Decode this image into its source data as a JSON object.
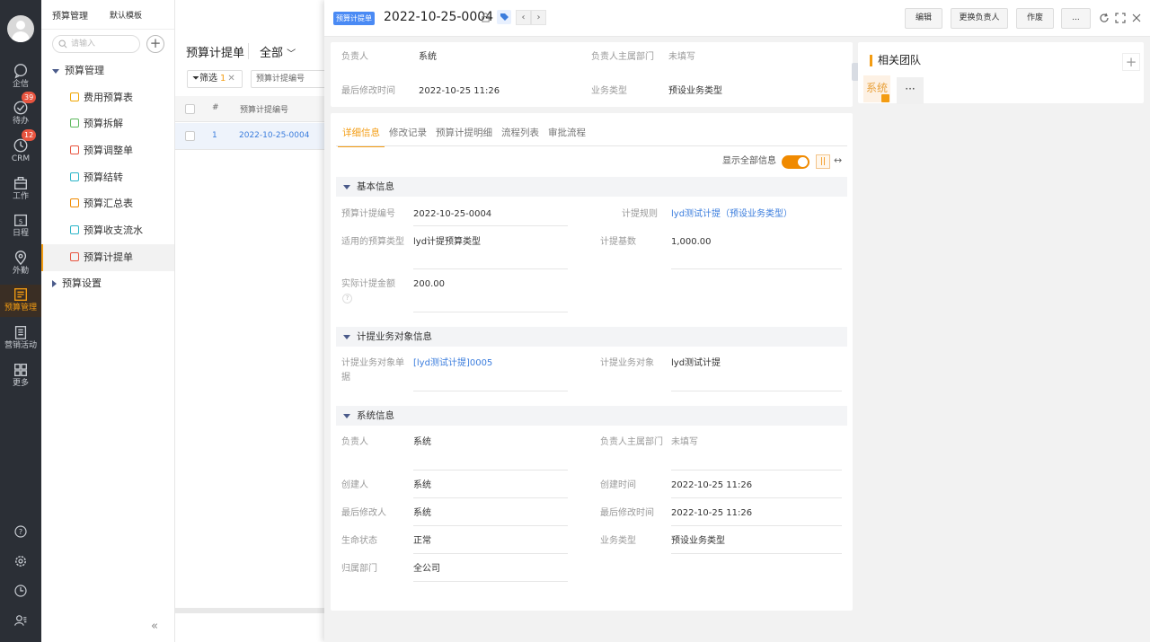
{
  "rail": {
    "items": [
      {
        "label": "企信",
        "icon": "chat-icon"
      },
      {
        "label": "待办",
        "icon": "check-circle-icon",
        "badge": "39"
      },
      {
        "label": "CRM",
        "icon": "clock-icon",
        "badge": "12"
      },
      {
        "label": "工作",
        "icon": "briefcase-icon"
      },
      {
        "label": "日程",
        "icon": "calendar-icon",
        "day": "5"
      },
      {
        "label": "外勤",
        "icon": "location-icon"
      },
      {
        "label": "预算管理",
        "icon": "budget-icon",
        "active": true
      },
      {
        "label": "营销活动",
        "icon": "marketing-icon"
      },
      {
        "label": "更多",
        "icon": "grid-icon"
      }
    ],
    "bottom_icons": [
      "help-icon",
      "settings-icon",
      "history-icon",
      "contacts-icon"
    ],
    "accent": "#f39c12"
  },
  "tree": {
    "tabs": [
      "预算管理",
      "默认模板"
    ],
    "search_placeholder": "请输入",
    "group_open": "预算管理",
    "items": [
      {
        "label": "费用预算表",
        "color": "#f0a500"
      },
      {
        "label": "预算拆解",
        "color": "#5cb85c"
      },
      {
        "label": "预算调整单",
        "color": "#e8543f"
      },
      {
        "label": "预算结转",
        "color": "#2bb5c8"
      },
      {
        "label": "预算汇总表",
        "color": "#f08a00"
      },
      {
        "label": "预算收支流水",
        "color": "#2bb5c8"
      },
      {
        "label": "预算计提单",
        "color": "#e8543f",
        "active": true
      }
    ],
    "group_closed": "预算设置",
    "collapse": "«"
  },
  "list": {
    "title": "预算计提单",
    "scope": "全部",
    "filter_label": "筛选",
    "filter_count": "1",
    "field_select": "预算计提编号",
    "columns": [
      "#",
      "预算计提编号"
    ],
    "rows": [
      {
        "index": "1",
        "code": "2022-10-25-0004"
      }
    ]
  },
  "detail": {
    "object_tag": "预算计提单",
    "title": "2022-10-25-0004",
    "prev": "‹",
    "next": "›",
    "buttons": [
      "编辑",
      "更换负责人",
      "作废",
      "..."
    ],
    "summary": {
      "owner_label": "负责人",
      "owner": "系统",
      "dept_label": "负责人主属部门",
      "dept": "未填写",
      "modified_label": "最后修改时间",
      "modified": "2022-10-25 11:26",
      "biztype_label": "业务类型",
      "biztype": "预设业务类型"
    },
    "tabs": [
      "详细信息",
      "修改记录",
      "预算计提明细",
      "流程列表",
      "审批流程"
    ],
    "show_all_label": "显示全部信息",
    "sections": {
      "basic": {
        "title": "基本信息",
        "code_label": "预算计提编号",
        "code": "2022-10-25-0004",
        "rule_label": "计提规则",
        "rule": "lyd测试计提（预设业务类型）",
        "type_label": "适用的预算类型",
        "type": "lyd计提预算类型",
        "base_label": "计提基数",
        "base": "1,000.00",
        "actual_label": "实际计提金额",
        "actual": "200.00",
        "help": "?"
      },
      "object": {
        "title": "计提业务对象信息",
        "doc_label": "计提业务对象单据",
        "doc": "[lyd测试计提]0005",
        "obj_label": "计提业务对象",
        "obj": "lyd测试计提"
      },
      "system": {
        "title": "系统信息",
        "owner_label": "负责人",
        "owner": "系统",
        "dept_label": "负责人主属部门",
        "dept": "未填写",
        "creator_label": "创建人",
        "creator": "系统",
        "created_label": "创建时间",
        "created": "2022-10-25 11:26",
        "modifier_label": "最后修改人",
        "modifier": "系统",
        "modified_label": "最后修改时间",
        "modified": "2022-10-25 11:26",
        "status_label": "生命状态",
        "status": "正常",
        "biztype_label": "业务类型",
        "biztype": "预设业务类型",
        "org_label": "归属部门",
        "org": "全公司"
      }
    },
    "team": {
      "title": "相关团队",
      "member": "系统",
      "more": "···",
      "add": "+"
    }
  }
}
